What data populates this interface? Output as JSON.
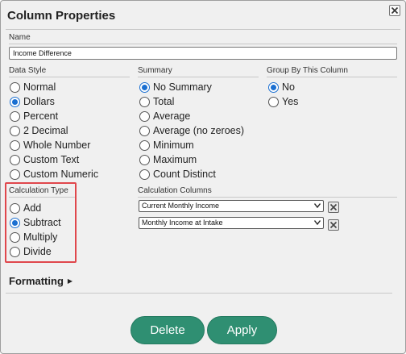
{
  "dialog": {
    "title": "Column Properties",
    "close_icon": "close-icon"
  },
  "name": {
    "label": "Name",
    "value": "Income Difference"
  },
  "data_style": {
    "label": "Data Style",
    "options": [
      {
        "label": "Normal",
        "checked": false
      },
      {
        "label": "Dollars",
        "checked": true
      },
      {
        "label": "Percent",
        "checked": false
      },
      {
        "label": "2 Decimal",
        "checked": false
      },
      {
        "label": "Whole Number",
        "checked": false
      },
      {
        "label": "Custom Text",
        "checked": false
      },
      {
        "label": "Custom Numeric",
        "checked": false
      }
    ]
  },
  "summary": {
    "label": "Summary",
    "options": [
      {
        "label": "No Summary",
        "checked": true
      },
      {
        "label": "Total",
        "checked": false
      },
      {
        "label": "Average",
        "checked": false
      },
      {
        "label": "Average (no zeroes)",
        "checked": false
      },
      {
        "label": "Minimum",
        "checked": false
      },
      {
        "label": "Maximum",
        "checked": false
      },
      {
        "label": "Count Distinct",
        "checked": false
      }
    ]
  },
  "group_by": {
    "label": "Group By This Column",
    "options": [
      {
        "label": "No",
        "checked": true
      },
      {
        "label": "Yes",
        "checked": false
      }
    ]
  },
  "calculation_type": {
    "label": "Calculation Type",
    "options": [
      {
        "label": "Add",
        "checked": false
      },
      {
        "label": "Subtract",
        "checked": true
      },
      {
        "label": "Multiply",
        "checked": false
      },
      {
        "label": "Divide",
        "checked": false
      }
    ],
    "highlight_color": "#e0474c"
  },
  "calculation_columns": {
    "label": "Calculation Columns",
    "selects": [
      {
        "value": "Current Monthly Income"
      },
      {
        "value": "Monthly Income at Intake"
      }
    ]
  },
  "formatting": {
    "label": "Formatting",
    "arrow": "▶"
  },
  "buttons": {
    "delete_label": "Delete",
    "apply_label": "Apply",
    "color": "#2f8f72"
  },
  "colors": {
    "radio_accent": "#1a6fd1",
    "background": "#f0f0f0"
  }
}
